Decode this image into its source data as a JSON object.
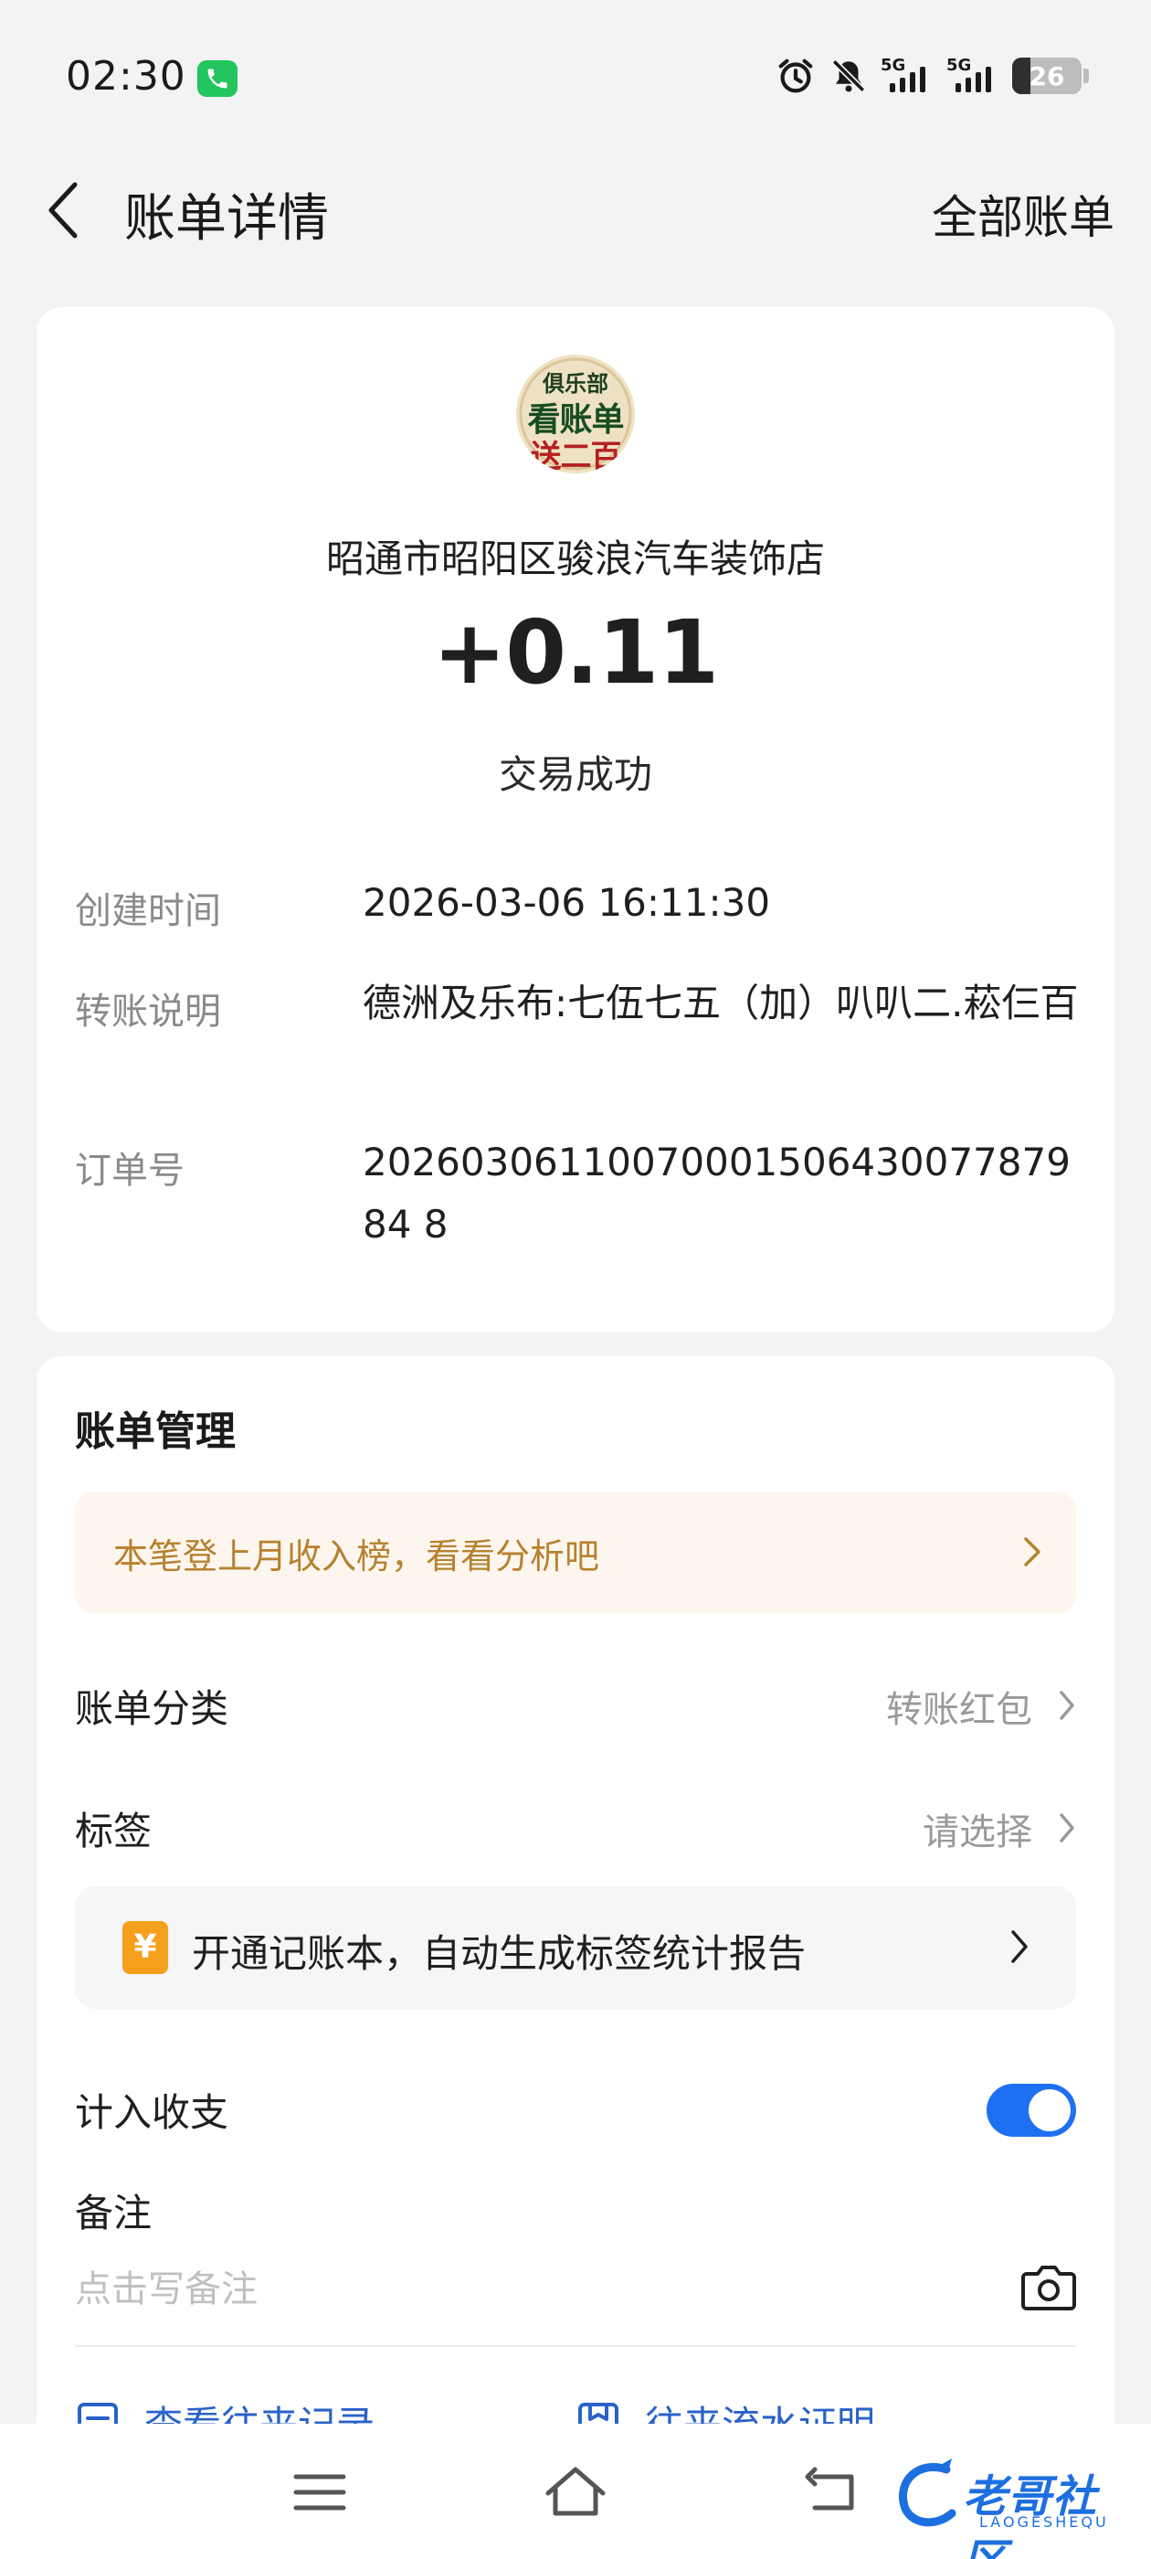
{
  "status_bar": {
    "time": "02:30",
    "network_label_1": "5G",
    "network_label_2": "5G",
    "battery_level": "26",
    "battery_fraction": 0.26,
    "call_color": "#22c55e"
  },
  "header": {
    "title": "账单详情",
    "all_bills_label": "全部账单"
  },
  "summary": {
    "logo_line1": "俱乐部",
    "logo_line2": "看账单",
    "logo_line3": "送二百",
    "merchant": "昭通市昭阳区骏浪汽车装饰店",
    "amount": "+0.11",
    "status": "交易成功"
  },
  "details": [
    {
      "label": "创建时间",
      "value": "2026-03-06 16:11:30"
    },
    {
      "label": "转账说明",
      "value": "德洲及乐布:七伍七五（加）叭叭二.菘仨百"
    },
    {
      "label": "订单号",
      "value": "2026030611007000150643007787984 8"
    }
  ],
  "management": {
    "title": "账单管理",
    "promo_text": "本笔登上月收入榜，看看分析吧",
    "category_label": "账单分类",
    "category_value": "转账红包",
    "tag_label": "标签",
    "tag_value": "请选择",
    "ledger_icon_text": "¥",
    "ledger_text": "开通记账本，自动生成标签统计报告",
    "include_label": "计入收支",
    "include_enabled": true,
    "remark_label": "备注",
    "remark_placeholder": "点击写备注",
    "links": [
      "查看往来记录",
      "往来流水证明"
    ]
  },
  "watermark": {
    "text": "老哥社区",
    "sub": "LAOGESHEQU"
  },
  "colors": {
    "accent": "#1f6ff2",
    "promo_text": "#b7812f",
    "promo_bg": "#fdf6ee",
    "ledger_icon": "#f4a01c",
    "link": "#2a62c9"
  },
  "icons": [
    "call-icon",
    "alarm-icon",
    "mute-icon",
    "signal-icon",
    "battery-icon",
    "back-icon",
    "chevron-right-icon",
    "ledger-icon",
    "camera-icon",
    "menu-icon",
    "home-icon",
    "back-nav-icon"
  ]
}
